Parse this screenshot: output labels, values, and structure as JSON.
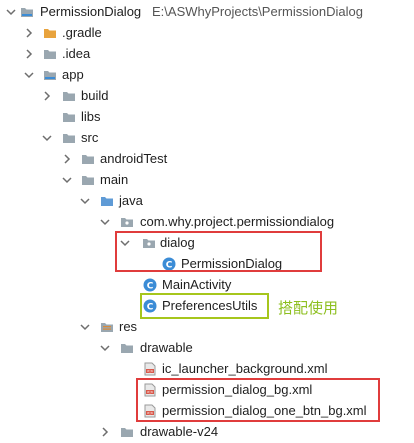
{
  "project": {
    "name": "PermissionDialog",
    "path": "E:\\ASWhyProjects\\PermissionDialog"
  },
  "tree": {
    "gradle": ".gradle",
    "idea": ".idea",
    "app": "app",
    "build": "build",
    "libs": "libs",
    "src": "src",
    "androidTest": "androidTest",
    "main": "main",
    "java": "java",
    "package": "com.why.project.permissiondialog",
    "dialog": "dialog",
    "permissionDialog": "PermissionDialog",
    "mainActivity": "MainActivity",
    "preferencesUtils": "PreferencesUtils",
    "res": "res",
    "drawable": "drawable",
    "icLauncherBg": "ic_launcher_background.xml",
    "permissionDialogBg": "permission_dialog_bg.xml",
    "permissionDialogOneBtnBg": "permission_dialog_one_btn_bg.xml",
    "drawableV24": "drawable-v24"
  },
  "annotation": "搭配使用",
  "colors": {
    "highlight_red": "#e03c3c",
    "highlight_green": "#a6c61c",
    "annotation_text": "#8dbf1f",
    "folder": "#9aa7b0",
    "folder_orange": "#e8a33d",
    "class_icon": "#3b8cd6"
  }
}
